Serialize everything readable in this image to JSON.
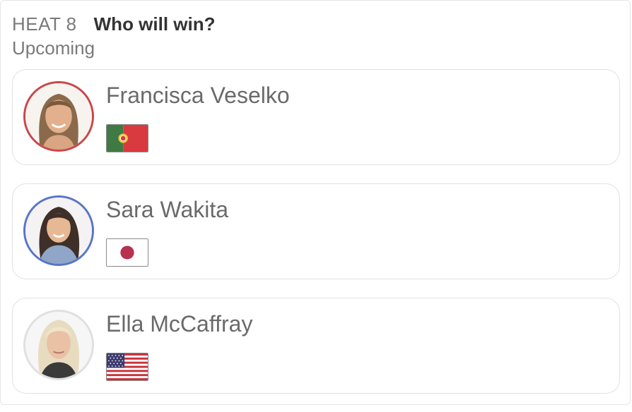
{
  "heat": {
    "label": "HEAT 8",
    "question": "Who will win?",
    "status": "Upcoming"
  },
  "colors": {
    "ring_1": "#c8474b",
    "ring_2": "#5875c9",
    "ring_3": "#e0e0e0"
  },
  "surfers": [
    {
      "name": "Francisca Veselko",
      "flag_icon": "portugal-flag-icon",
      "avatar_icon": "surfer-photo-icon"
    },
    {
      "name": "Sara Wakita",
      "flag_icon": "japan-flag-icon",
      "avatar_icon": "surfer-photo-icon"
    },
    {
      "name": "Ella McCaffray",
      "flag_icon": "usa-flag-icon",
      "avatar_icon": "surfer-photo-icon"
    }
  ]
}
